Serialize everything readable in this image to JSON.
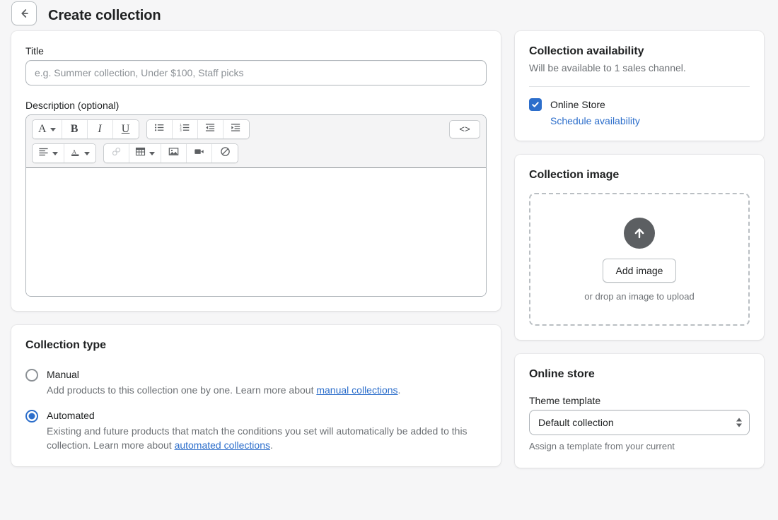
{
  "header": {
    "back_icon": "arrow-left-icon",
    "title": "Create collection"
  },
  "main": {
    "title_field": {
      "label": "Title",
      "value": "",
      "placeholder": "e.g. Summer collection, Under $100, Staff picks"
    },
    "description_field": {
      "label": "Description (optional)",
      "value": ""
    },
    "editor_toolbar": {
      "row1": [
        {
          "name": "font-style-dropdown",
          "glyph": "A",
          "has_caret": true,
          "disabled": false
        },
        {
          "name": "bold-button",
          "glyph": "B",
          "has_caret": false,
          "disabled": false
        },
        {
          "name": "italic-button",
          "glyph": "I",
          "has_caret": false,
          "disabled": false
        },
        {
          "name": "underline-button",
          "glyph": "U",
          "has_caret": false,
          "disabled": false
        },
        {
          "name": "bulleted-list-button",
          "glyph": "",
          "has_caret": false,
          "disabled": false
        },
        {
          "name": "numbered-list-button",
          "glyph": "",
          "has_caret": false,
          "disabled": false
        },
        {
          "name": "outdent-button",
          "glyph": "",
          "has_caret": false,
          "disabled": false
        },
        {
          "name": "indent-button",
          "glyph": "",
          "has_caret": false,
          "disabled": false
        }
      ],
      "code_button_label": "<>",
      "row2": [
        {
          "name": "text-align-dropdown",
          "has_caret": true,
          "disabled": false
        },
        {
          "name": "text-color-dropdown",
          "has_caret": true,
          "disabled": false
        },
        {
          "name": "insert-link-button",
          "has_caret": false,
          "disabled": true
        },
        {
          "name": "insert-table-dropdown",
          "has_caret": true,
          "disabled": false
        },
        {
          "name": "insert-image-button",
          "has_caret": false,
          "disabled": false
        },
        {
          "name": "insert-video-button",
          "has_caret": false,
          "disabled": false
        },
        {
          "name": "clear-formatting-button",
          "has_caret": false,
          "disabled": false
        }
      ]
    },
    "collection_type": {
      "title": "Collection type",
      "options": [
        {
          "label": "Manual",
          "selected": false,
          "help_before": "Add products to this collection one by one. Learn more about ",
          "help_link": "manual collections",
          "help_after": "."
        },
        {
          "label": "Automated",
          "selected": true,
          "help_before": "Existing and future products that match the conditions you set will automatically be added to this collection. Learn more about ",
          "help_link": "automated collections",
          "help_after": "."
        }
      ]
    }
  },
  "sidebar": {
    "availability": {
      "title": "Collection availability",
      "subtitle": "Will be available to 1 sales channel.",
      "channel_label": "Online Store",
      "channel_checked": true,
      "schedule_link": "Schedule availability"
    },
    "collection_image": {
      "title": "Collection image",
      "upload_icon": "upload-arrow-icon",
      "add_button_label": "Add image",
      "drop_hint": "or drop an image to upload"
    },
    "online_store": {
      "title": "Online store",
      "template_label": "Theme template",
      "template_value": "Default collection",
      "help_text": "Assign a template from your current"
    }
  },
  "colors": {
    "accent": "#2c6ecb",
    "page_bg": "#f6f6f7",
    "card_bg": "#ffffff",
    "text": "#202223",
    "subdued": "#6d7175",
    "border": "#aeb4b9"
  }
}
